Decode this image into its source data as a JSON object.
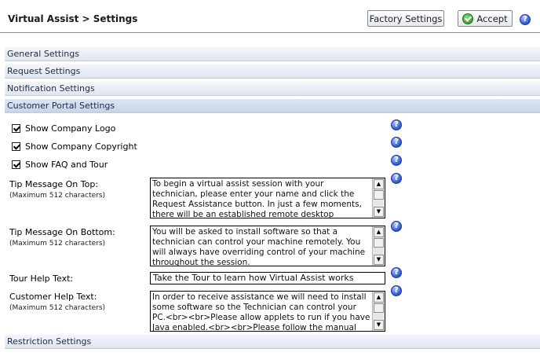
{
  "header": {
    "title": "Virtual Assist > Settings",
    "factory_button": "Factory Settings",
    "accept_button": "Accept",
    "help_icon": "help-question-icon"
  },
  "sections": {
    "general": "General Settings",
    "request": "Request Settings",
    "notification": "Notification Settings",
    "portal": "Customer Portal Settings",
    "restriction": "Restriction Settings"
  },
  "portal": {
    "show_logo": {
      "label": "Show Company Logo",
      "checked": true
    },
    "show_copyright": {
      "label": "Show Company Copyright",
      "checked": true
    },
    "show_faq": {
      "label": "Show FAQ and Tour",
      "checked": true
    },
    "tip_top": {
      "label": "Tip Message On Top:",
      "hint": "(Maximum 512 characters)",
      "value": "To begin a virtual assist session with your technician, please enter your name and click the Request Assistance button. In just a few moments, there will be an established remote desktop connection between your"
    },
    "tip_bottom": {
      "label": "Tip Message On Bottom:",
      "hint": "(Maximum 512 characters)",
      "value": "You will be asked to install software so that a technician can control your machine remotely. You will always have overriding control of your machine throughout the session."
    },
    "tour_help": {
      "label": "Tour Help Text:",
      "value": "Take the Tour to learn how Virtual Assist works"
    },
    "customer_help": {
      "label": "Customer Help Text:",
      "hint": "(Maximum 512 characters)",
      "value": "In order to receive assistance we will need to install some software so the Technician can control your PC.<br><br>Please allow applets to run if you have Java enabled.<br><br>Please follow the manual"
    }
  },
  "colors": {
    "section_bg": "#dfe5ef",
    "active_section_bg": "#c8d4e6",
    "help_blue": "#2b53c9",
    "accept_green": "#1e8d1b"
  }
}
